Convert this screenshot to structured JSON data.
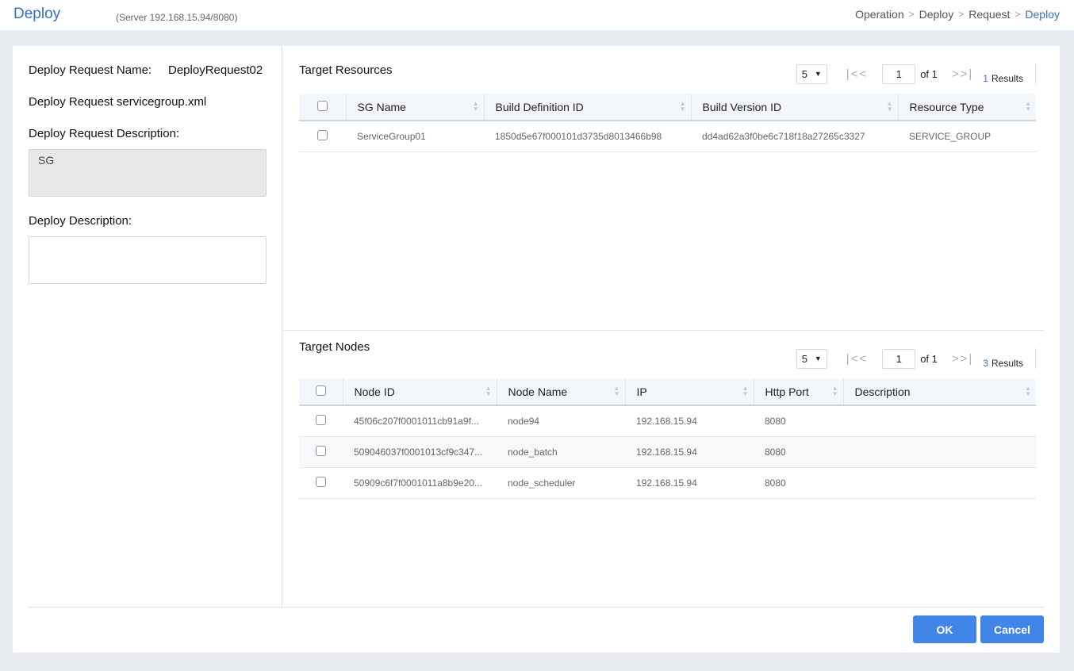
{
  "header": {
    "title": "Deploy",
    "server": "(Server 192.168.15.94/8080)",
    "breadcrumb": [
      "Operation",
      "Deploy",
      "Request",
      "Deploy"
    ],
    "breadcrumb_sep": ">"
  },
  "left": {
    "request_name_label": "Deploy Request Name:",
    "request_name_value": "DeployRequest02",
    "request_file_label": "Deploy Request servicegroup.xml",
    "request_desc_label": "Deploy Request Description:",
    "request_desc_value": "SG",
    "deploy_desc_label": "Deploy Description:",
    "deploy_desc_value": ""
  },
  "resources": {
    "title": "Target Resources",
    "page_size": "5",
    "page": "1",
    "of_label": "of 1",
    "results_count": "1",
    "results_label": "Results",
    "columns": [
      "SG Name",
      "Build Definition ID",
      "Build Version ID",
      "Resource Type"
    ],
    "rows": [
      [
        "ServiceGroup01",
        "1850d5e67f000101d3735d8013466b98",
        "dd4ad62a3f0be6c718f18a27265c3327",
        "SERVICE_GROUP"
      ]
    ]
  },
  "nodes": {
    "title": "Target Nodes",
    "page_size": "5",
    "page": "1",
    "of_label": "of 1",
    "results_count": "3",
    "results_label": "Results",
    "columns": [
      "Node ID",
      "Node Name",
      "IP",
      "Http Port",
      "Description"
    ],
    "rows": [
      [
        "45f06c207f0001011cb91a9f...",
        "node94",
        "192.168.15.94",
        "8080",
        ""
      ],
      [
        "509046037f0001013cf9c347...",
        "node_batch",
        "192.168.15.94",
        "8080",
        ""
      ],
      [
        "50909c6f7f0001011a8b9e20...",
        "node_scheduler",
        "192.168.15.94",
        "8080",
        ""
      ]
    ]
  },
  "buttons": {
    "ok": "OK",
    "cancel": "Cancel"
  },
  "colors": {
    "accent": "#3a6fc7",
    "button": "#4285e8"
  }
}
